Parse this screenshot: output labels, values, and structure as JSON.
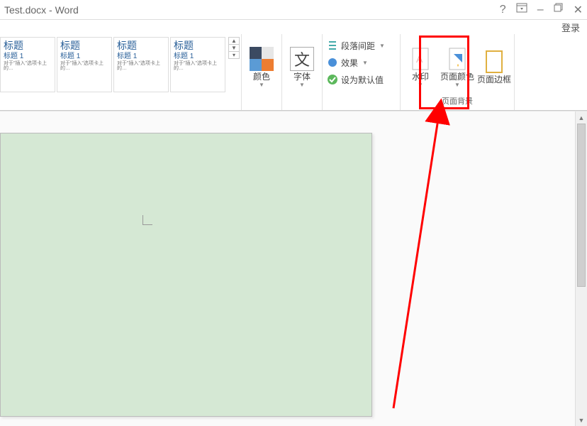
{
  "title": "Test.docx - Word",
  "login": "登录",
  "window_controls": {
    "help": "?",
    "ribbon_opts_icon": "ribbon-options-icon",
    "minimize": "–",
    "restore_icon": "restore-icon",
    "close": "✕"
  },
  "ribbon": {
    "styles": {
      "items": [
        {
          "title": "标题",
          "sub": "标题 1",
          "body": "对于\"插入\"选项卡上的…"
        },
        {
          "title": "标题",
          "sub": "标题 1",
          "body": "对于\"插入\"选项卡上的…"
        },
        {
          "title": "标题",
          "sub": "标题 1",
          "body": "对于\"插入\"选项卡上的…"
        },
        {
          "title": "标题",
          "sub": "标题 1",
          "body": "对于\"插入\"选项卡上的…"
        }
      ]
    },
    "colors_label": "颜色",
    "fonts_label": "字体",
    "font_glyph": "文",
    "paragraph_spacing": "段落间距",
    "effects": "效果",
    "set_default": "设为默认值",
    "watermark": "水印",
    "page_color": "页面颜色",
    "page_border": "页面边框",
    "page_bg_group": "页面背景"
  }
}
